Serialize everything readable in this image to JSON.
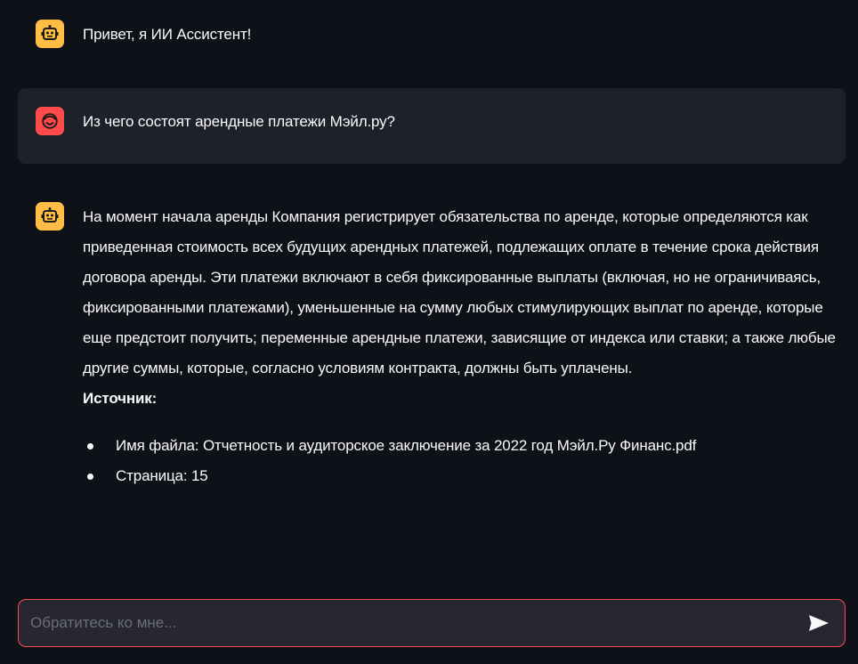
{
  "messages": [
    {
      "role": "assistant",
      "avatar_icon": "robot-icon",
      "text": "Привет, я ИИ Ассистент!"
    },
    {
      "role": "user",
      "avatar_icon": "smiley-face-icon",
      "text": "Из чего состоят арендные платежи Мэйл.ру?"
    },
    {
      "role": "assistant",
      "avatar_icon": "robot-icon",
      "text": "На момент начала аренды Компания регистрирует обязательства по аренде, которые определяются как приведенная стоимость всех будущих арендных платежей, подлежащих оплате в течение срока действия договора аренды. Эти платежи включают в себя фиксированные выплаты (включая, но не ограничиваясь, фиксированными платежами), уменьшенные на сумму любых стимулирующих выплат по аренде, которые еще предстоит получить; переменные арендные платежи, зависящие от индекса или ставки; а также любые другие суммы, которые, согласно условиям контракта, должны быть уплачены.",
      "source_title": "Источник:",
      "sources": [
        "Имя файла: Отчетность и аудиторское заключение за 2022 год Мэйл.Ру Финанс.pdf",
        "Страница: 15"
      ]
    }
  ],
  "chat_input": {
    "placeholder": "Обратитесь ко мне...",
    "value": "",
    "send_icon": "send-icon"
  },
  "colors": {
    "background": "#0e1117",
    "user_message_bg": "#1e212a",
    "assistant_avatar": "#ffbd45",
    "user_avatar": "#ff4b4b",
    "input_border": "#ff4b4b",
    "input_bg": "#262730"
  }
}
